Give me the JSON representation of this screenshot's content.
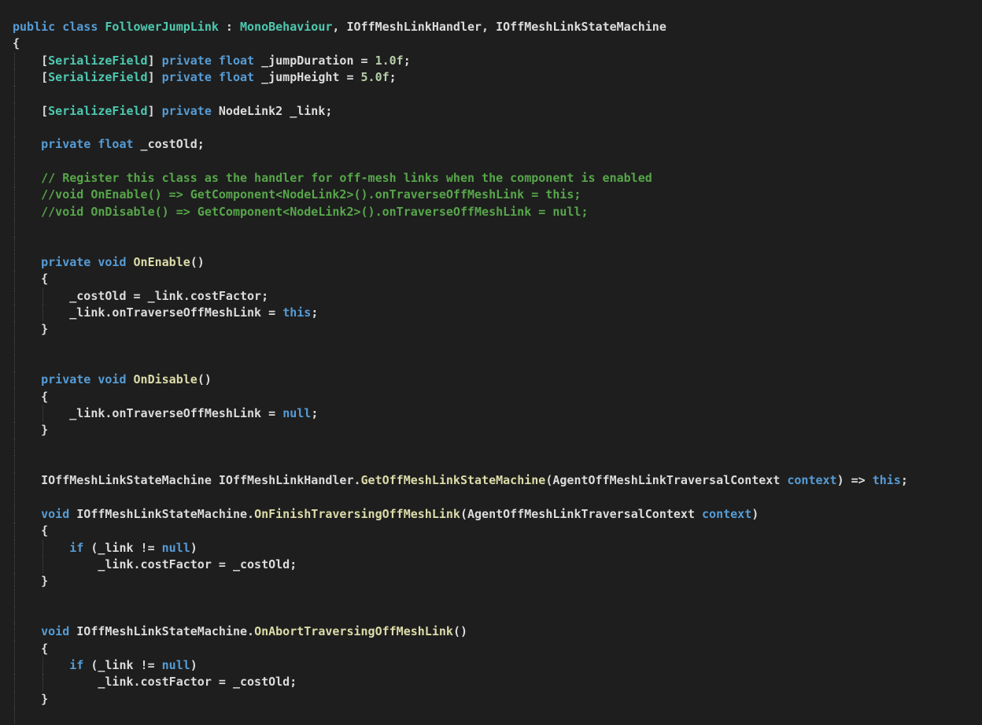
{
  "editor": {
    "theme_colors": {
      "background": "#1e1e1e",
      "plain": "#dcdcdc",
      "keyword": "#569cd6",
      "type": "#4ec9b0",
      "method": "#dcdcaa",
      "number": "#b5cea8",
      "comment": "#57a64a",
      "indent_guide": "#4a4a4a"
    },
    "lines": [
      {
        "indent": 0,
        "tokens": [
          [
            "kw",
            "public"
          ],
          [
            "plain",
            " "
          ],
          [
            "kw",
            "class"
          ],
          [
            "plain",
            " "
          ],
          [
            "type",
            "FollowerJumpLink"
          ],
          [
            "plain",
            " : "
          ],
          [
            "type",
            "MonoBehaviour"
          ],
          [
            "plain",
            ", IOffMeshLinkHandler, IOffMeshLinkStateMachine"
          ]
        ]
      },
      {
        "indent": 0,
        "tokens": [
          [
            "plain",
            "{"
          ]
        ]
      },
      {
        "indent": 1,
        "tokens": [
          [
            "plain",
            "["
          ],
          [
            "type",
            "SerializeField"
          ],
          [
            "plain",
            "] "
          ],
          [
            "kw",
            "private"
          ],
          [
            "plain",
            " "
          ],
          [
            "kw",
            "float"
          ],
          [
            "plain",
            " _jumpDuration = "
          ],
          [
            "num",
            "1.0f"
          ],
          [
            "plain",
            ";"
          ]
        ]
      },
      {
        "indent": 1,
        "tokens": [
          [
            "plain",
            "["
          ],
          [
            "type",
            "SerializeField"
          ],
          [
            "plain",
            "] "
          ],
          [
            "kw",
            "private"
          ],
          [
            "plain",
            " "
          ],
          [
            "kw",
            "float"
          ],
          [
            "plain",
            " _jumpHeight = "
          ],
          [
            "num",
            "5.0f"
          ],
          [
            "plain",
            ";"
          ]
        ]
      },
      {
        "indent": 1,
        "tokens": []
      },
      {
        "indent": 1,
        "tokens": [
          [
            "plain",
            "["
          ],
          [
            "type",
            "SerializeField"
          ],
          [
            "plain",
            "] "
          ],
          [
            "kw",
            "private"
          ],
          [
            "plain",
            " NodeLink2 _link;"
          ]
        ]
      },
      {
        "indent": 1,
        "tokens": []
      },
      {
        "indent": 1,
        "tokens": [
          [
            "kw",
            "private"
          ],
          [
            "plain",
            " "
          ],
          [
            "kw",
            "float"
          ],
          [
            "plain",
            " _costOld;"
          ]
        ]
      },
      {
        "indent": 1,
        "tokens": []
      },
      {
        "indent": 1,
        "tokens": [
          [
            "comment",
            "// Register this class as the handler for off-mesh links when the component is enabled"
          ]
        ]
      },
      {
        "indent": 1,
        "tokens": [
          [
            "comment",
            "//void OnEnable() => GetComponent<NodeLink2>().onTraverseOffMeshLink = this;"
          ]
        ]
      },
      {
        "indent": 1,
        "tokens": [
          [
            "comment",
            "//void OnDisable() => GetComponent<NodeLink2>().onTraverseOffMeshLink = null;"
          ]
        ]
      },
      {
        "indent": 1,
        "tokens": []
      },
      {
        "indent": 1,
        "tokens": []
      },
      {
        "indent": 1,
        "tokens": [
          [
            "kw",
            "private"
          ],
          [
            "plain",
            " "
          ],
          [
            "kw",
            "void"
          ],
          [
            "plain",
            " "
          ],
          [
            "method",
            "OnEnable"
          ],
          [
            "plain",
            "()"
          ]
        ]
      },
      {
        "indent": 1,
        "tokens": [
          [
            "plain",
            "{"
          ]
        ]
      },
      {
        "indent": 2,
        "tokens": [
          [
            "plain",
            "_costOld = _link.costFactor;"
          ]
        ]
      },
      {
        "indent": 2,
        "tokens": [
          [
            "plain",
            "_link.onTraverseOffMeshLink = "
          ],
          [
            "kw",
            "this"
          ],
          [
            "plain",
            ";"
          ]
        ]
      },
      {
        "indent": 1,
        "tokens": [
          [
            "plain",
            "}"
          ]
        ]
      },
      {
        "indent": 1,
        "tokens": []
      },
      {
        "indent": 1,
        "tokens": []
      },
      {
        "indent": 1,
        "tokens": [
          [
            "kw",
            "private"
          ],
          [
            "plain",
            " "
          ],
          [
            "kw",
            "void"
          ],
          [
            "plain",
            " "
          ],
          [
            "method",
            "OnDisable"
          ],
          [
            "plain",
            "()"
          ]
        ]
      },
      {
        "indent": 1,
        "tokens": [
          [
            "plain",
            "{"
          ]
        ]
      },
      {
        "indent": 2,
        "tokens": [
          [
            "plain",
            "_link.onTraverseOffMeshLink = "
          ],
          [
            "kw",
            "null"
          ],
          [
            "plain",
            ";"
          ]
        ]
      },
      {
        "indent": 1,
        "tokens": [
          [
            "plain",
            "}"
          ]
        ]
      },
      {
        "indent": 1,
        "tokens": []
      },
      {
        "indent": 1,
        "tokens": []
      },
      {
        "indent": 1,
        "tokens": [
          [
            "plain",
            "IOffMeshLinkStateMachine IOffMeshLinkHandler."
          ],
          [
            "method",
            "GetOffMeshLinkStateMachine"
          ],
          [
            "plain",
            "(AgentOffMeshLinkTraversalContext "
          ],
          [
            "kw",
            "context"
          ],
          [
            "plain",
            ") => "
          ],
          [
            "kw",
            "this"
          ],
          [
            "plain",
            ";"
          ]
        ]
      },
      {
        "indent": 1,
        "tokens": []
      },
      {
        "indent": 1,
        "tokens": [
          [
            "kw",
            "void"
          ],
          [
            "plain",
            " IOffMeshLinkStateMachine."
          ],
          [
            "method",
            "OnFinishTraversingOffMeshLink"
          ],
          [
            "plain",
            "(AgentOffMeshLinkTraversalContext "
          ],
          [
            "kw",
            "context"
          ],
          [
            "plain",
            ")"
          ]
        ]
      },
      {
        "indent": 1,
        "tokens": [
          [
            "plain",
            "{"
          ]
        ]
      },
      {
        "indent": 2,
        "tokens": [
          [
            "kw",
            "if"
          ],
          [
            "plain",
            " (_link != "
          ],
          [
            "kw",
            "null"
          ],
          [
            "plain",
            ")"
          ]
        ]
      },
      {
        "indent": 2,
        "tokens": [
          [
            "plain",
            "    _link.costFactor = _costOld;"
          ]
        ]
      },
      {
        "indent": 1,
        "tokens": [
          [
            "plain",
            "}"
          ]
        ]
      },
      {
        "indent": 1,
        "tokens": []
      },
      {
        "indent": 1,
        "tokens": []
      },
      {
        "indent": 1,
        "tokens": [
          [
            "kw",
            "void"
          ],
          [
            "plain",
            " IOffMeshLinkStateMachine."
          ],
          [
            "method",
            "OnAbortTraversingOffMeshLink"
          ],
          [
            "plain",
            "()"
          ]
        ]
      },
      {
        "indent": 1,
        "tokens": [
          [
            "plain",
            "{"
          ]
        ]
      },
      {
        "indent": 2,
        "tokens": [
          [
            "kw",
            "if"
          ],
          [
            "plain",
            " (_link != "
          ],
          [
            "kw",
            "null"
          ],
          [
            "plain",
            ")"
          ]
        ]
      },
      {
        "indent": 2,
        "tokens": [
          [
            "plain",
            "    _link.costFactor = _costOld;"
          ]
        ]
      },
      {
        "indent": 1,
        "tokens": [
          [
            "plain",
            "}"
          ]
        ]
      },
      {
        "indent": 1,
        "tokens": []
      }
    ]
  }
}
